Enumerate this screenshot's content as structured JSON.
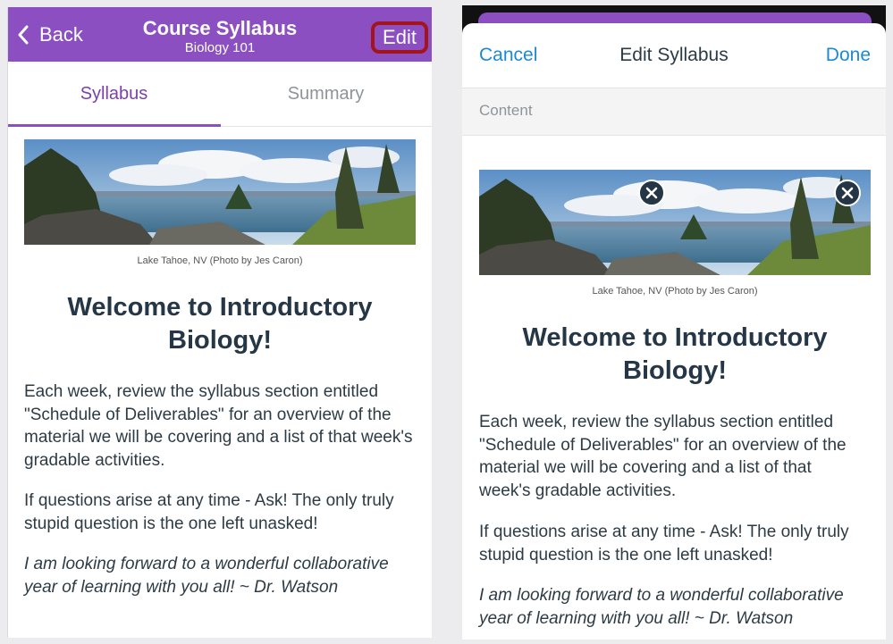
{
  "left": {
    "header": {
      "back_label": "Back",
      "title": "Course Syllabus",
      "subtitle": "Biology 101",
      "edit_label": "Edit"
    },
    "tabs": [
      {
        "label": "Syllabus",
        "active": true
      },
      {
        "label": "Summary",
        "active": false
      }
    ],
    "content": {
      "caption": "Lake Tahoe, NV (Photo by Jes Caron)",
      "heading_line1": "Welcome to Introductory",
      "heading_line2": "Biology!",
      "paragraphs": [
        "Each week, review the syllabus section entitled \"Schedule of Deliverables\" for an overview of the material we will be covering and a list of that week's gradable activities.",
        "If questions arise at any time - Ask!  The only truly stupid question is the one left unasked!",
        "I am looking forward to a wonderful collaborative year of learning with you all! ~ Dr. Watson"
      ]
    }
  },
  "right": {
    "header": {
      "cancel_label": "Cancel",
      "title": "Edit Syllabus",
      "done_label": "Done"
    },
    "section_label": "Content",
    "content": {
      "caption": "Lake Tahoe, NV (Photo by Jes Caron)",
      "heading_line1": "Welcome to Introductory",
      "heading_line2": "Biology!",
      "paragraphs": [
        "Each week, review the syllabus section entitled \"Schedule of Deliverables\" for an overview of the material we will be covering and a list of that week's gradable activities.",
        "If questions arise at any time - Ask!  The only truly stupid question is the one left unasked!",
        "I am looking forward to a wonderful collaborative year of learning with you all! ~ Dr. Watson"
      ]
    }
  },
  "colors": {
    "brand_purple": "#8b4fc2",
    "link_blue": "#1b8ad6",
    "highlight_red": "#a3141c",
    "text_dark": "#2d3b45"
  },
  "icons": {
    "back": "chevron-left-icon",
    "remove_image": "close-icon"
  }
}
